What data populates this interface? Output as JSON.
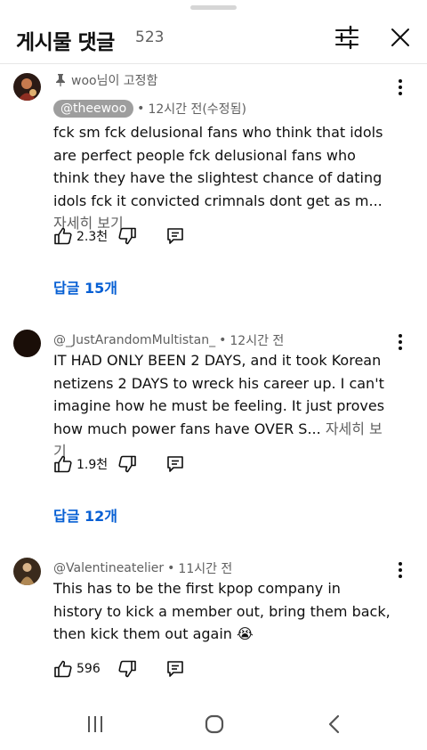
{
  "header": {
    "title": "게시물 댓글",
    "count": "523",
    "filter_icon": "sliders-icon",
    "close_icon": "close-icon"
  },
  "comments": [
    {
      "pinned_label": "woo님이 고정함",
      "author": "@theewoo",
      "time": "12시간 전(수정됨)",
      "text": "fck sm fck delusional fans who think that idols are perfect people fck delusional fans who think they have the slightest chance of dating idols fck it convicted crimnals dont get as m...",
      "more": "자세히 보기",
      "likes": "2.3천",
      "replies": "답글 15개"
    },
    {
      "author": "@_JustArandomMultistan_",
      "time": "12시간 전",
      "text": "IT HAD ONLY BEEN 2 DAYS, and it took Korean netizens 2 DAYS to wreck his career up. I can't imagine how he must be feeling. It just proves how much power fans have OVER S...",
      "more": "자세히 보기",
      "likes": "1.9천",
      "replies": "답글 12개"
    },
    {
      "author": "@Valentineatelier",
      "time": "11시간 전",
      "text": "This has to be the first kpop company in history to kick a member out, bring them back, then kick them out again 😭",
      "likes": "596"
    }
  ],
  "colors": {
    "link_blue": "#065fd4",
    "secondary_text": "#606060",
    "handle_badge_bg": "#9e9e9e"
  }
}
